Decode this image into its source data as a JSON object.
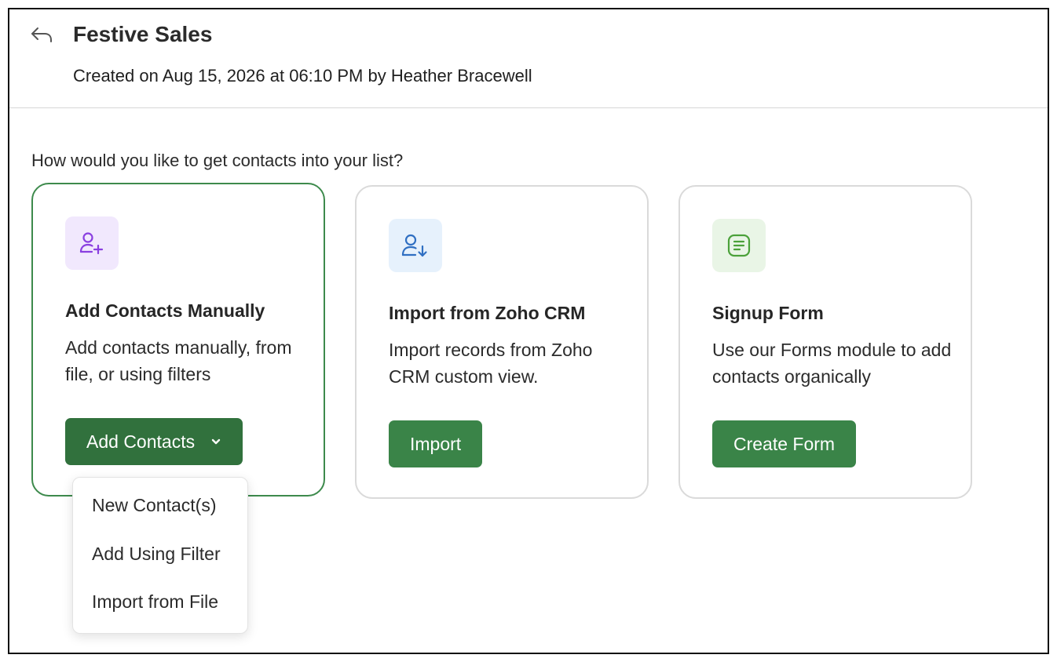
{
  "header": {
    "title": "Festive Sales",
    "subtitle": "Created on Aug 15, 2026 at 06:10 PM by Heather Bracewell"
  },
  "question": "How would you like to get contacts into your list?",
  "cards": [
    {
      "icon": "user-add-icon",
      "icon_bg": "#f1e8fd",
      "icon_color": "#8a3fe0",
      "title": "Add Contacts Manually",
      "description": "Add contacts manually, from file, or using filters",
      "button_label": "Add Contacts"
    },
    {
      "icon": "user-import-icon",
      "icon_bg": "#e6f1fc",
      "icon_color": "#2f6fc2",
      "title": "Import from Zoho CRM",
      "description": "Import records from Zoho CRM custom view.",
      "button_label": "Import"
    },
    {
      "icon": "form-icon",
      "icon_bg": "#e9f5e6",
      "icon_color": "#4ba13a",
      "title": "Signup Form",
      "description": "Use our Forms module to add contacts organically",
      "button_label": "Create Form"
    }
  ],
  "dropdown": {
    "items": [
      "New Contact(s)",
      "Add Using Filter",
      "Import from File"
    ]
  },
  "colors": {
    "primary_button": "#3a8448",
    "active_border": "#3d8a4c"
  }
}
